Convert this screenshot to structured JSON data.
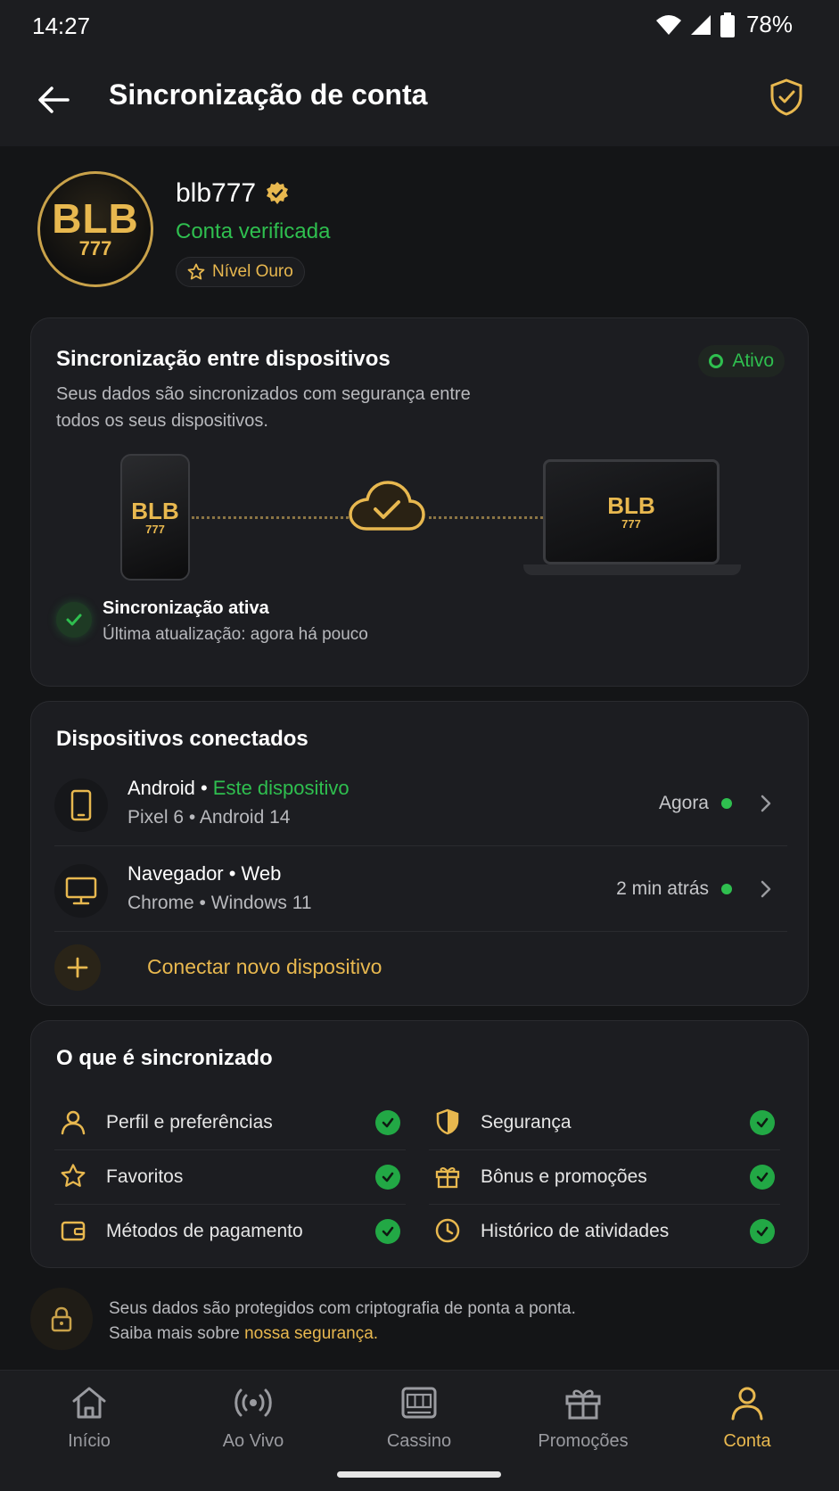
{
  "status_bar": {
    "time": "14:27",
    "battery": "78%"
  },
  "header": {
    "title": "Sincronização de conta"
  },
  "profile": {
    "avatar_big": "BLB",
    "avatar_small": "777",
    "username": "blb777",
    "verified": "Conta verificada",
    "level": "Nível Ouro"
  },
  "sync_card": {
    "title": "Sincronização entre dispositivos",
    "description": "Seus dados são sincronizados com segurança entre todos os seus dispositivos.",
    "status_badge": "Ativo",
    "status_title": "Sincronização ativa",
    "status_sub": "Última atualização: agora há pouco"
  },
  "devices": {
    "title": "Dispositivos conectados",
    "items": [
      {
        "name": "Android",
        "tag": "Este dispositivo",
        "sub": "Pixel 6 • Android 14",
        "time": "Agora"
      },
      {
        "name": "Navegador • Web",
        "tag": "",
        "sub": "Chrome • Windows 11",
        "time": "2 min atrás"
      }
    ],
    "connect_label": "Conectar novo dispositivo"
  },
  "synced": {
    "title": "O que é sincronizado",
    "left": [
      "Perfil e preferências",
      "Favoritos",
      "Métodos de pagamento"
    ],
    "right": [
      "Segurança",
      "Bônus e promoções",
      "Histórico de atividades"
    ]
  },
  "security_note": {
    "line1": "Seus dados são protegidos com criptografia de ponta a ponta.",
    "line2_prefix": "Saiba mais sobre ",
    "line2_link": "nossa segurança."
  },
  "nav": {
    "items": [
      "Início",
      "Ao Vivo",
      "Cassino",
      "Promoções",
      "Conta"
    ],
    "active": "Conta"
  },
  "colors": {
    "accent_gold": "#e8b84f",
    "success_green": "#2fbf4f",
    "background": "#141517",
    "card": "#1c1d21"
  }
}
